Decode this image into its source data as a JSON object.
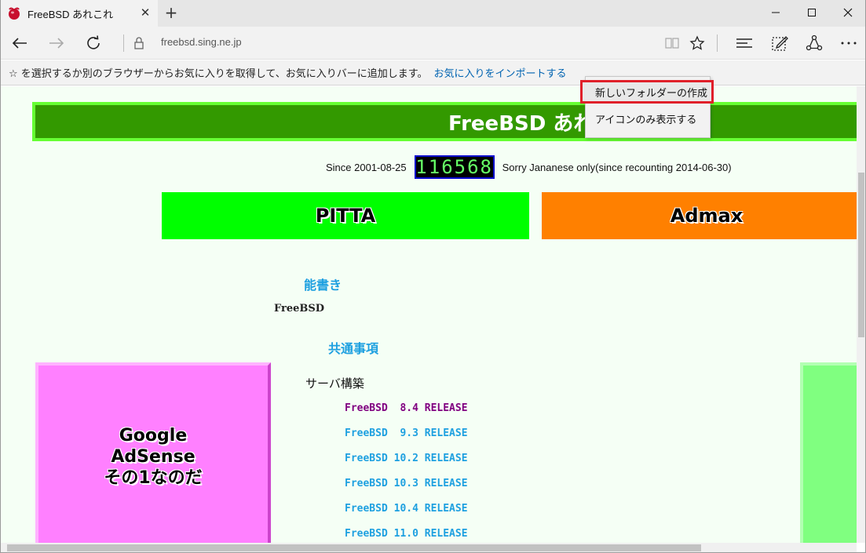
{
  "tab": {
    "title": "FreeBSD あれこれ"
  },
  "window_controls": {
    "minimize": "─",
    "maximize": "☐",
    "close": "✕"
  },
  "nav": {
    "url": "freebsd.sing.ne.jp"
  },
  "favorites_bar": {
    "prompt": "☆ を選択するか別のブラウザーからお気に入りを取得して、お気に入りバーに追加します。",
    "import_link": "お気に入りをインポートする"
  },
  "context_menu": {
    "items": [
      "新しいフォルダーの作成",
      "アイコンのみ表示する"
    ]
  },
  "page": {
    "banner_title": "FreeBSD あれこ",
    "since_label": "Since 2001-08-25",
    "counter": "116568",
    "sorry_label": "Sorry  Jananese only(since recounting 2014-06-30)",
    "ad_left": "PITTA",
    "ad_right": "Admax",
    "section_noh": "能書き",
    "freebsd_text": "FreeBSD",
    "section_common": "共通事項",
    "server_title": "サーバ構築",
    "releases": [
      {
        "label": "FreeBSD  8.4 RELEASE",
        "color": "#800080"
      },
      {
        "label": "FreeBSD  9.3 RELEASE",
        "color": "#1ea0e0"
      },
      {
        "label": "FreeBSD 10.2 RELEASE",
        "color": "#1ea0e0"
      },
      {
        "label": "FreeBSD 10.3 RELEASE",
        "color": "#1ea0e0"
      },
      {
        "label": "FreeBSD 10.4 RELEASE",
        "color": "#1ea0e0"
      },
      {
        "label": "FreeBSD 11.0 RELEASE",
        "color": "#1ea0e0"
      }
    ],
    "adsense_lines": [
      "Google",
      "AdSense",
      "その1なのだ"
    ]
  },
  "colors": {
    "banner_bg": "#339900",
    "pitta_bg": "#00ff00",
    "admax_bg": "#ff8000",
    "adsense_bg": "#ff80ff",
    "accent_link": "#0063b1",
    "highlight_border": "#e0202a"
  }
}
